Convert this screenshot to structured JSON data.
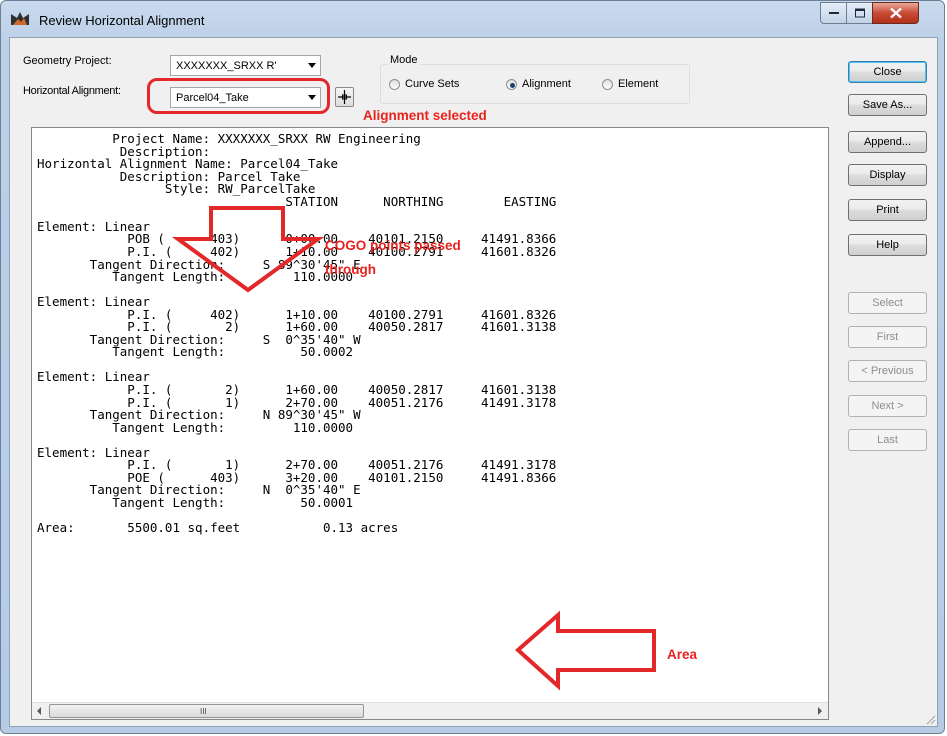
{
  "window": {
    "title": "Review Horizontal Alignment"
  },
  "form": {
    "geometry_project_label": "Geometry Project:",
    "geometry_project_value": "XXXXXXX_SRXX R'",
    "horizontal_alignment_label": "Horizontal Alignment:",
    "horizontal_alignment_value": "Parcel04_Take",
    "mode_label": "Mode",
    "mode_options": [
      "Curve Sets",
      "Alignment",
      "Element"
    ],
    "mode_selected": "Alignment"
  },
  "report": {
    "lines": [
      "          Project Name: XXXXXXX_SRXX RW Engineering",
      "           Description:",
      "Horizontal Alignment Name: Parcel04_Take",
      "           Description: Parcel Take",
      "                 Style: RW_ParcelTake",
      "                                 STATION      NORTHING        EASTING",
      "",
      "Element: Linear",
      "            POB (      403)      0+00.00    40101.2150     41491.8366",
      "            P.I. (     402)      1+10.00    40100.2791     41601.8326",
      "       Tangent Direction:     S 89^30'45\" E",
      "          Tangent Length:         110.0000",
      "",
      "Element: Linear",
      "            P.I. (     402)      1+10.00    40100.2791     41601.8326",
      "            P.I. (       2)      1+60.00    40050.2817     41601.3138",
      "       Tangent Direction:     S  0^35'40\" W",
      "          Tangent Length:          50.0002",
      "",
      "Element: Linear",
      "            P.I. (       2)      1+60.00    40050.2817     41601.3138",
      "            P.I. (       1)      2+70.00    40051.2176     41491.3178",
      "       Tangent Direction:     N 89^30'45\" W",
      "          Tangent Length:         110.0000",
      "",
      "Element: Linear",
      "            P.I. (       1)      2+70.00    40051.2176     41491.3178",
      "            POE (      403)      3+20.00    40101.2150     41491.8366",
      "       Tangent Direction:     N  0^35'40\" E",
      "          Tangent Length:          50.0001",
      "",
      "Area:       5500.01 sq.feet           0.13 acres"
    ],
    "scroll_grip": "III"
  },
  "buttons": {
    "close": "Close",
    "save_as": "Save As...",
    "append": "Append...",
    "display": "Display",
    "print": "Print",
    "help": "Help",
    "select": "Select",
    "first": "First",
    "previous": "< Previous",
    "next": "Next >",
    "last": "Last"
  },
  "annotations": {
    "alignment_selected": "Alignment selected",
    "cogo_line1": "COGO points passed",
    "cogo_line2": "through",
    "area": "Area",
    "color": "#e3282a"
  }
}
